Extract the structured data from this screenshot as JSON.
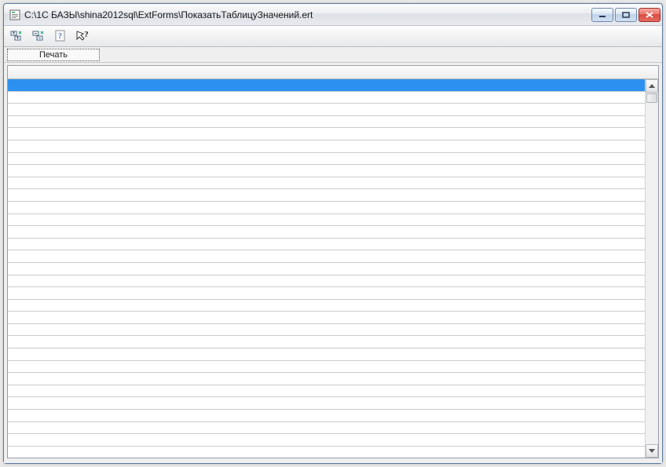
{
  "window": {
    "title": "C:\\1C БАЗЫ\\shina2012sql\\ExtForms\\ПоказатьТаблицуЗначений.ert"
  },
  "subbar": {
    "print_label": "Печать"
  },
  "toolbar": {
    "icons": {
      "expand_all": "expand-all-icon",
      "collapse_all": "collapse-all-icon",
      "help": "help-icon",
      "whats_this": "whats-this-icon"
    }
  },
  "grid": {
    "row_count": 30,
    "selected_index": 0
  }
}
